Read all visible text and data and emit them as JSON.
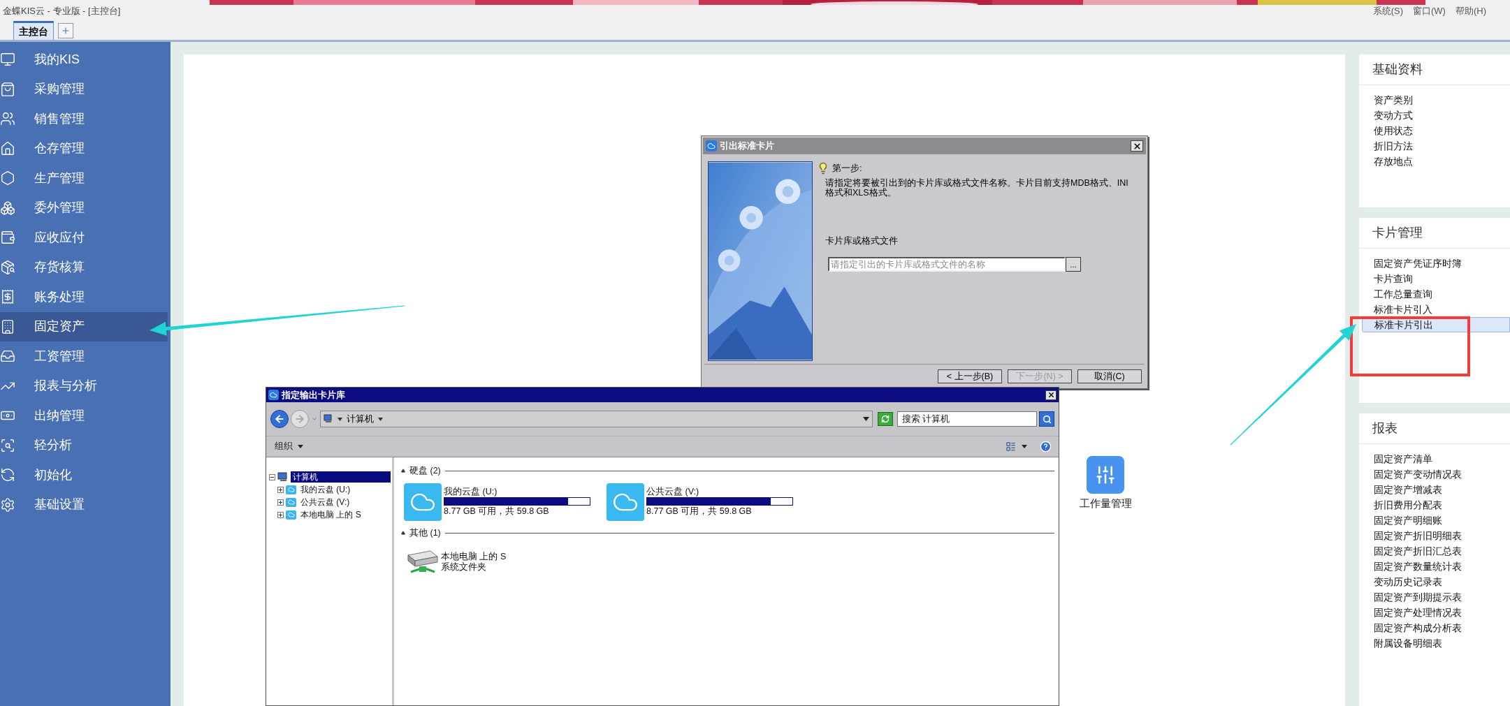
{
  "window": {
    "title": "金蝶KIS云 - 专业版 - [主控台]",
    "menus": [
      "系统(S)",
      "窗口(W)",
      "帮助(H)"
    ]
  },
  "tabs": [
    {
      "label": "主控台",
      "selected": true
    }
  ],
  "sidebar": {
    "items": [
      {
        "label": "我的KIS",
        "selected": false
      },
      {
        "label": "采购管理",
        "selected": false
      },
      {
        "label": "销售管理",
        "selected": false
      },
      {
        "label": "仓存管理",
        "selected": false
      },
      {
        "label": "生产管理",
        "selected": false
      },
      {
        "label": "委外管理",
        "selected": false
      },
      {
        "label": "应收应付",
        "selected": false
      },
      {
        "label": "存货核算",
        "selected": false
      },
      {
        "label": "账务处理",
        "selected": false
      },
      {
        "label": "固定资产",
        "selected": true
      },
      {
        "label": "工资管理",
        "selected": false
      },
      {
        "label": "报表与分析",
        "selected": false
      },
      {
        "label": "出纳管理",
        "selected": false
      },
      {
        "label": "轻分析",
        "selected": false
      },
      {
        "label": "初始化",
        "selected": false
      },
      {
        "label": "基础设置",
        "selected": false
      }
    ]
  },
  "workspace": {
    "shortcuts": [
      {
        "label": "工作量管理"
      }
    ]
  },
  "right_panel": {
    "sections": [
      {
        "title": "基础资料",
        "items": [
          {
            "label": "资产类别",
            "selected": false
          },
          {
            "label": "变动方式",
            "selected": false
          },
          {
            "label": "使用状态",
            "selected": false
          },
          {
            "label": "折旧方法",
            "selected": false
          },
          {
            "label": "存放地点",
            "selected": false
          }
        ]
      },
      {
        "title": "卡片管理",
        "items": [
          {
            "label": "固定资产凭证序时簿",
            "selected": false
          },
          {
            "label": "卡片查询",
            "selected": false
          },
          {
            "label": "工作总量查询",
            "selected": false
          },
          {
            "label": "标准卡片引入",
            "selected": false
          },
          {
            "label": "标准卡片引出",
            "selected": true
          }
        ]
      },
      {
        "title": "报表",
        "items": [
          {
            "label": "固定资产清单",
            "selected": false
          },
          {
            "label": "固定资产变动情况表",
            "selected": false
          },
          {
            "label": "固定资产增减表",
            "selected": false
          },
          {
            "label": "折旧费用分配表",
            "selected": false
          },
          {
            "label": "固定资产明细账",
            "selected": false
          },
          {
            "label": "固定资产折旧明细表",
            "selected": false
          },
          {
            "label": "固定资产折旧汇总表",
            "selected": false
          },
          {
            "label": "固定资产数量统计表",
            "selected": false
          },
          {
            "label": "变动历史记录表",
            "selected": false
          },
          {
            "label": "固定资产到期提示表",
            "selected": false
          },
          {
            "label": "固定资产处理情况表",
            "selected": false
          },
          {
            "label": "固定资产构成分析表",
            "selected": false
          },
          {
            "label": "附属设备明细表",
            "selected": false
          }
        ]
      }
    ]
  },
  "export_dialog": {
    "title": "引出标准卡片",
    "step": "第一步:",
    "description": "请指定将要被引出到的卡片库或格式文件名称。卡片目前支持MDB格式、INI格式和XLS格式。",
    "field_label": "卡片库或格式文件",
    "field_placeholder": "请指定引出的卡片库或格式文件的名称",
    "browse": "...",
    "buttons": [
      {
        "label": "< 上一步(B)",
        "disabled": false
      },
      {
        "label": "下一步(N) >",
        "disabled": true
      },
      {
        "label": "取消(C)",
        "disabled": false
      }
    ]
  },
  "library_dialog": {
    "title": "指定输出卡片库",
    "address": "计算机",
    "search_placeholder": "搜索 计算机",
    "organize": "组织",
    "tree": [
      {
        "label": "计算机",
        "selected": true,
        "expanded": true,
        "children": [
          {
            "label": "我的云盘 (U:)",
            "selected": false,
            "expanded": false
          },
          {
            "label": "公共云盘 (V:)",
            "selected": false,
            "expanded": false
          },
          {
            "label": "本地电脑 上的 S",
            "selected": false,
            "expanded": false
          }
        ]
      }
    ],
    "groups": [
      {
        "title": "硬盘 (2)",
        "items": [
          {
            "kind": "drive",
            "name": "我的云盘 (U:)",
            "level": 0.85,
            "info": "8.77 GB 可用，共 59.8 GB"
          },
          {
            "kind": "drive",
            "name": "公共云盘 (V:)",
            "level": 0.85,
            "info": "8.77 GB 可用，共 59.8 GB"
          }
        ]
      },
      {
        "title": "其他 (1)",
        "items": [
          {
            "kind": "folder",
            "name": "本地电脑 上的 S",
            "info": "系统文件夹"
          }
        ]
      }
    ]
  }
}
